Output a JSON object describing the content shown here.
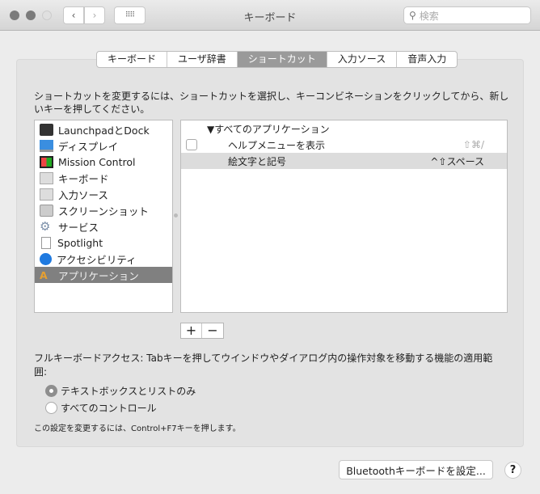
{
  "window": {
    "title": "キーボード",
    "search_placeholder": "検索"
  },
  "tabs": [
    {
      "label": "キーボード"
    },
    {
      "label": "ユーザ辞書"
    },
    {
      "label": "ショートカット",
      "selected": true
    },
    {
      "label": "入力ソース"
    },
    {
      "label": "音声入力"
    }
  ],
  "description": "ショートカットを変更するには、ショートカットを選択し、キーコンビネーションをクリックしてから、新しいキーを押してください。",
  "categories": [
    {
      "label": "LaunchpadとDock",
      "icon": "launchpad-icon"
    },
    {
      "label": "ディスプレイ",
      "icon": "display-icon"
    },
    {
      "label": "Mission Control",
      "icon": "mission-control-icon"
    },
    {
      "label": "キーボード",
      "icon": "keyboard-icon"
    },
    {
      "label": "入力ソース",
      "icon": "keyboard-icon"
    },
    {
      "label": "スクリーンショット",
      "icon": "screenshot-icon"
    },
    {
      "label": "サービス",
      "icon": "gear-icon"
    },
    {
      "label": "Spotlight",
      "icon": "spotlight-icon"
    },
    {
      "label": "アクセシビリティ",
      "icon": "accessibility-icon"
    },
    {
      "label": "アプリケーション",
      "icon": "app-icon",
      "selected": true
    }
  ],
  "shortcuts": {
    "group": "▼すべてのアプリケーション",
    "rows": [
      {
        "name": "ヘルプメニューを表示",
        "keys": "⇧⌘/",
        "checked": false
      },
      {
        "name": "絵文字と記号",
        "keys": "^⇧スペース",
        "selected": true
      }
    ]
  },
  "buttons": {
    "add": "+",
    "remove": "−",
    "bluetooth": "Bluetoothキーボードを設定...",
    "help": "?"
  },
  "full_keyboard": {
    "label": "フルキーボードアクセス: Tabキーを押してウインドウやダイアログ内の操作対象を移動する機能の適用範囲:",
    "options": [
      {
        "label": "テキストボックスとリストのみ",
        "selected": true
      },
      {
        "label": "すべてのコントロール",
        "selected": false
      }
    ],
    "note": "この設定を変更するには、Control+F7キーを押します。"
  }
}
